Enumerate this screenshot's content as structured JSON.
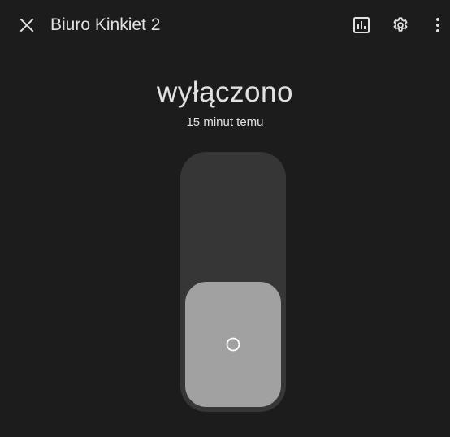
{
  "header": {
    "title": "Biuro Kinkiet 2",
    "close_icon": "close-icon",
    "history_icon": "bar-chart-icon",
    "settings_icon": "gear-icon",
    "more_icon": "more-vertical-icon"
  },
  "main": {
    "state": "wyłączono",
    "last_changed": "15 minut temu",
    "toggle": {
      "is_on": false,
      "knob_icon": "power-off-circle-icon"
    }
  },
  "colors": {
    "background": "#1c1c1c",
    "track": "#363636",
    "knob": "#a1a1a1",
    "text": "#e1e1e1"
  }
}
